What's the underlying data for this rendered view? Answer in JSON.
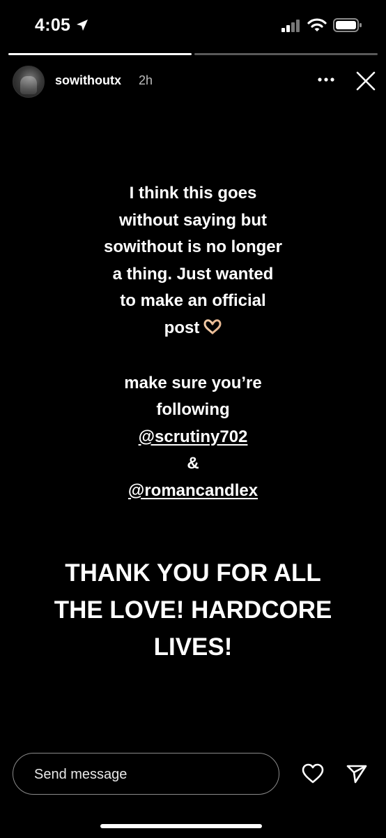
{
  "status": {
    "time": "4:05",
    "icons": [
      "location-arrow-icon",
      "cellular-signal-icon",
      "wifi-icon",
      "battery-icon"
    ]
  },
  "progress": {
    "segments": [
      {
        "fill": 1.0
      },
      {
        "fill": 0.0
      }
    ]
  },
  "header": {
    "username": "sowithoutx",
    "age": "2h",
    "more_icon": "ellipsis-icon",
    "close_icon": "close-icon"
  },
  "story": {
    "lines": [
      "I think this goes",
      "without saying but",
      "sowithout is no longer",
      "a thing.  Just wanted",
      "to make an official",
      "post",
      "",
      "make sure you’re",
      "following",
      "@scrutiny702",
      "&",
      "@romancandlex"
    ],
    "emoji": "heart-hands-icon",
    "shout": [
      "THANK YOU FOR ALL",
      "THE LOVE! HARDCORE",
      "LIVES!"
    ]
  },
  "composer": {
    "placeholder": "Send message",
    "value": ""
  },
  "actions": {
    "like_icon": "heart-icon",
    "send_icon": "paper-plane-icon"
  },
  "colors": {
    "background": "#000000",
    "text": "#ffffff"
  }
}
